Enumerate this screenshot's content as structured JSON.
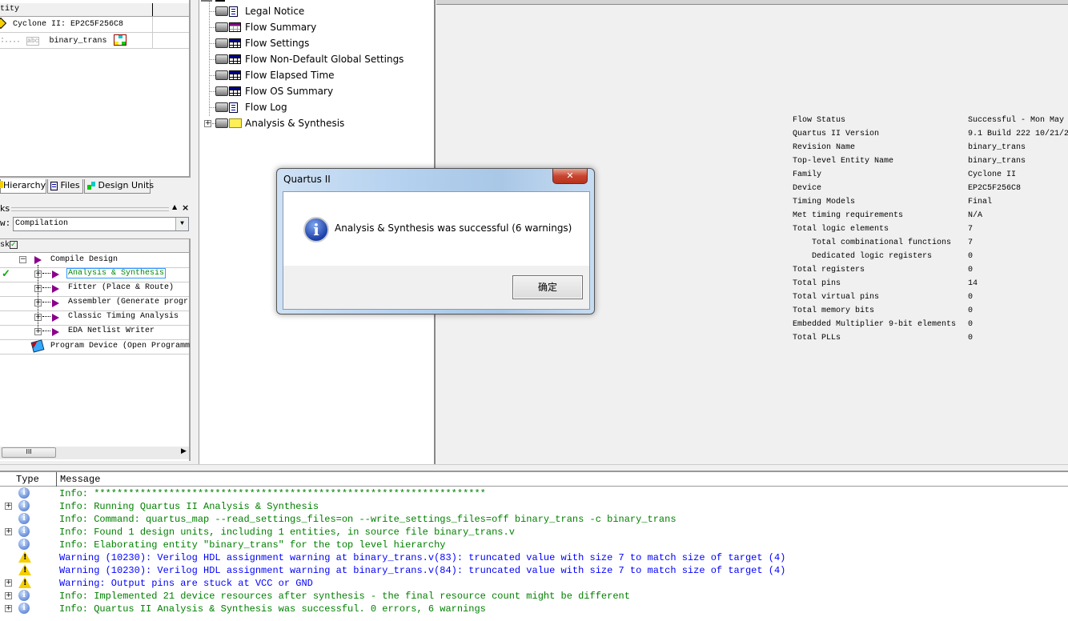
{
  "hierarchy": {
    "header": "Entity",
    "header_visible": "tity",
    "device": "Cyclone II: EP2C5F256C8",
    "entity": "binary_trans",
    "tabs": [
      "Hierarchy",
      "Files",
      "Design Units"
    ]
  },
  "tasks": {
    "title_visible": "ks",
    "flow_label_visible": "w:",
    "flow_value": "Compilation",
    "column_visible": "sk",
    "items": [
      {
        "label": "Compile Design",
        "status": ""
      },
      {
        "label": "Analysis & Synthesis",
        "status": "done"
      },
      {
        "label": "Fitter (Place & Route)",
        "status": ""
      },
      {
        "label": "Assembler (Generate progr",
        "status": ""
      },
      {
        "label": "Classic Timing Analysis",
        "status": ""
      },
      {
        "label": "EDA Netlist Writer",
        "status": ""
      },
      {
        "label": "Program Device (Open Programm",
        "status": ""
      }
    ],
    "scroll_grip": "III"
  },
  "report_tree": {
    "items": [
      "Legal Notice",
      "Flow Summary",
      "Flow Settings",
      "Flow Non-Default Global Settings",
      "Flow Elapsed Time",
      "Flow OS Summary",
      "Flow Log",
      "Analysis & Synthesis"
    ]
  },
  "summary": [
    {
      "k": "Flow Status",
      "v": "Successful - Mon May"
    },
    {
      "k": "Quartus II Version",
      "v": "9.1 Build 222 10/21/2"
    },
    {
      "k": "Revision Name",
      "v": "binary_trans"
    },
    {
      "k": "Top-level Entity Name",
      "v": "binary_trans"
    },
    {
      "k": "Family",
      "v": "Cyclone II"
    },
    {
      "k": "Device",
      "v": "EP2C5F256C8"
    },
    {
      "k": "Timing Models",
      "v": "Final"
    },
    {
      "k": "Met timing requirements",
      "v": "N/A"
    },
    {
      "k": "Total logic elements",
      "v": "7"
    },
    {
      "k": "    Total combinational functions",
      "v": "7"
    },
    {
      "k": "    Dedicated logic registers",
      "v": "0"
    },
    {
      "k": "Total registers",
      "v": "0"
    },
    {
      "k": "Total pins",
      "v": "14"
    },
    {
      "k": "Total virtual pins",
      "v": "0"
    },
    {
      "k": "Total memory bits",
      "v": "0"
    },
    {
      "k": "Embedded Multiplier 9-bit elements",
      "v": "0"
    },
    {
      "k": "Total PLLs",
      "v": "0"
    }
  ],
  "dialog": {
    "title": "Quartus II",
    "message": "Analysis & Synthesis was successful (6 warnings)",
    "ok_label": "确定",
    "close_label": "✕"
  },
  "messages": {
    "col_type": "Type",
    "col_message": "Message",
    "rows": [
      {
        "type": "info",
        "expand": false,
        "text": "Info: ********************************************************************"
      },
      {
        "type": "info",
        "expand": true,
        "text": "Info: Running Quartus II Analysis & Synthesis"
      },
      {
        "type": "info",
        "expand": false,
        "text": "Info: Command: quartus_map --read_settings_files=on --write_settings_files=off binary_trans -c binary_trans"
      },
      {
        "type": "info",
        "expand": true,
        "text": "Info: Found 1 design units, including 1 entities, in source file binary_trans.v"
      },
      {
        "type": "info",
        "expand": false,
        "text": "Info: Elaborating entity \"binary_trans\" for the top level hierarchy"
      },
      {
        "type": "warning",
        "expand": false,
        "text": "Warning (10230): Verilog HDL assignment warning at binary_trans.v(83): truncated value with size 7 to match size of target (4)"
      },
      {
        "type": "warning",
        "expand": false,
        "text": "Warning (10230): Verilog HDL assignment warning at binary_trans.v(84): truncated value with size 7 to match size of target (4)"
      },
      {
        "type": "warning",
        "expand": true,
        "text": "Warning: Output pins are stuck at VCC or GND"
      },
      {
        "type": "info",
        "expand": true,
        "text": "Info: Implemented 21 device resources after synthesis - the final resource count might be different"
      },
      {
        "type": "info",
        "expand": true,
        "text": "Info: Quartus II Analysis & Synthesis was successful. 0 errors, 6 warnings"
      }
    ]
  },
  "colors": {
    "info": "#008000",
    "warning": "#0000ff",
    "accent": "#8b008b"
  }
}
